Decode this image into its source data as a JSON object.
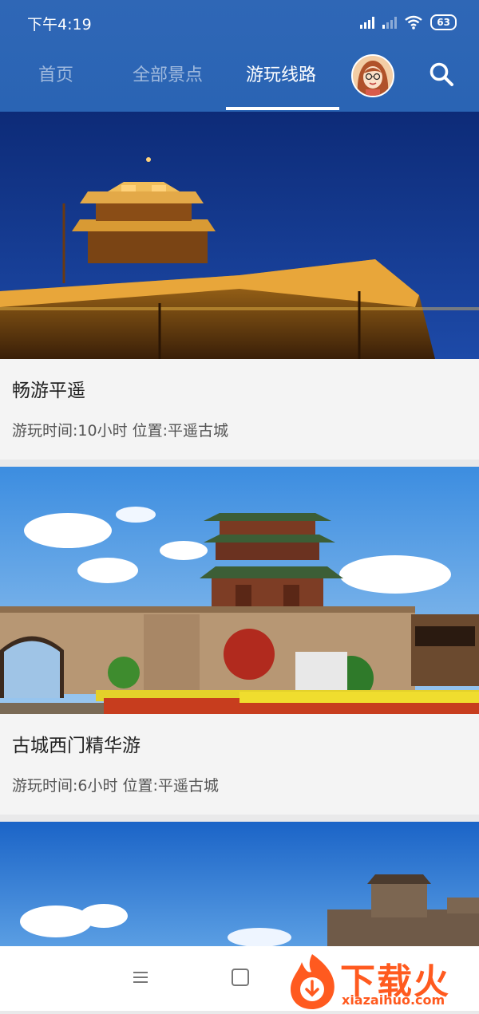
{
  "status_bar": {
    "time": "下午4:19",
    "battery": "63"
  },
  "nav": {
    "tabs": [
      {
        "label": "首页"
      },
      {
        "label": "全部景点"
      },
      {
        "label": "游玩线路"
      }
    ],
    "active_tab": "游玩线路",
    "search_icon": "search-icon",
    "avatar": "user-avatar"
  },
  "routes": [
    {
      "title": "畅游平遥",
      "meta": "游玩时间:10小时  位置:平遥古城",
      "image": "night city wall with illuminated gate tower"
    },
    {
      "title": "古城西门精华游",
      "meta": "游玩时间:6小时  位置:平遥古城",
      "image": "west gate tower with flowers and blue sky"
    },
    {
      "image": "brick watchtower under blue sky"
    }
  ],
  "bottom_nav": {
    "menu_icon": "menu-icon",
    "home_icon": "square-home-icon"
  },
  "watermark": {
    "brand": "下载火",
    "url": "xiazaihuo.com"
  },
  "colors": {
    "header": "#2a64b4",
    "active_tab": "#ffffff",
    "inactive_tab": "#9db6dc",
    "card_bg": "#f4f4f4",
    "watermark": "#ff5a1f"
  }
}
